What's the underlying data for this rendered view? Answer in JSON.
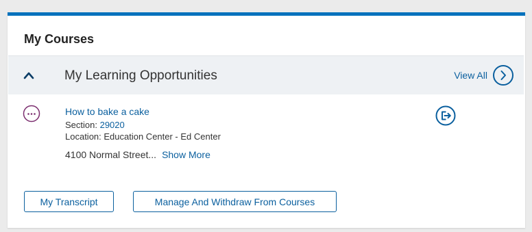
{
  "card": {
    "title": "My Courses"
  },
  "section": {
    "title": "My Learning Opportunities",
    "view_all_label": "View All"
  },
  "course": {
    "title": "How to bake a cake",
    "section_label": "Section: ",
    "section_number": "29020",
    "location": "Location: Education Center - Ed Center",
    "address": "4100 Normal Street...",
    "show_more": "Show More"
  },
  "actions": {
    "transcript_label": "My Transcript",
    "manage_label": "Manage And Withdraw From Courses"
  },
  "colors": {
    "accent": "#0071bc",
    "link": "#0a5f9e",
    "status_icon": "#7b2d6e",
    "header_bg": "#eef1f4",
    "page_bg": "#ebebeb"
  },
  "icons": {
    "collapse": "chevron-up-icon",
    "view_all": "chevron-right-circle-icon",
    "status": "more-dots-circle-icon",
    "withdraw": "exit-icon"
  }
}
